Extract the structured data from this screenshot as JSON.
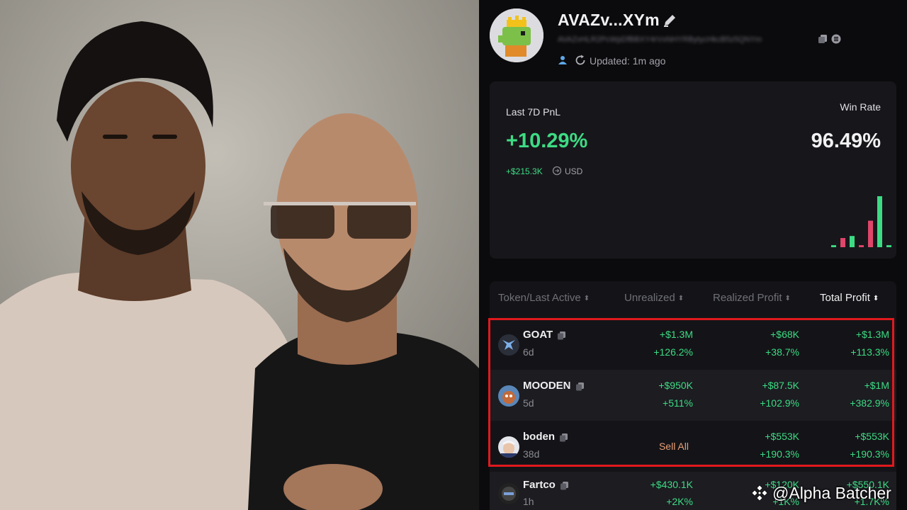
{
  "photo": {
    "alt_subject": "two-men-portrait"
  },
  "wallet": {
    "name": "AVAZv...XYm",
    "address": "AVAZvHLR2PcWpDfBBXY4rVxNHYRBytycHkcB5z5QNYm",
    "updated": "Updated: 1m ago"
  },
  "pnl": {
    "label": "Last 7D PnL",
    "value": "+10.29%",
    "usd_value": "+$215.3K",
    "usd_label": "USD",
    "winrate_label": "Win Rate",
    "winrate_value": "96.49%",
    "bars": [
      {
        "value": 0.04,
        "color": "#3ddc84"
      },
      {
        "value": 0.18,
        "color": "#e0456a"
      },
      {
        "value": 0.22,
        "color": "#3ddc84"
      },
      {
        "value": 0.04,
        "color": "#e0456a"
      },
      {
        "value": 0.52,
        "color": "#e0456a"
      },
      {
        "value": 1.0,
        "color": "#3ddc84"
      },
      {
        "value": 0.04,
        "color": "#3ddc84"
      }
    ]
  },
  "table": {
    "headers": [
      "Token/Last Active",
      "Unrealized",
      "Realized Profit",
      "Total Profit"
    ],
    "rows": [
      {
        "name": "GOAT",
        "age": "6d",
        "unrealized": [
          "+$1.3M",
          "+126.2%"
        ],
        "realized": [
          "+$68K",
          "+38.7%"
        ],
        "total": [
          "+$1.3M",
          "+113.3%"
        ]
      },
      {
        "name": "MOODEN",
        "age": "5d",
        "unrealized": [
          "+$950K",
          "+511%"
        ],
        "realized": [
          "+$87.5K",
          "+102.9%"
        ],
        "total": [
          "+$1M",
          "+382.9%"
        ]
      },
      {
        "name": "boden",
        "age": "38d",
        "sell_all": "Sell All",
        "realized": [
          "+$553K",
          "+190.3%"
        ],
        "total": [
          "+$553K",
          "+190.3%"
        ]
      },
      {
        "name": "Fartco",
        "age": "1h",
        "unrealized": [
          "+$430.1K",
          "+2K%"
        ],
        "realized": [
          "+$120K",
          "+1K%"
        ],
        "total": [
          "+$550.1K",
          "+1.7K%"
        ]
      }
    ]
  },
  "colors": {
    "positive": "#3ddc84",
    "highlight_border": "#e0191d",
    "sell_all": "#e89f77"
  },
  "watermark": "@Alpha Batcher"
}
